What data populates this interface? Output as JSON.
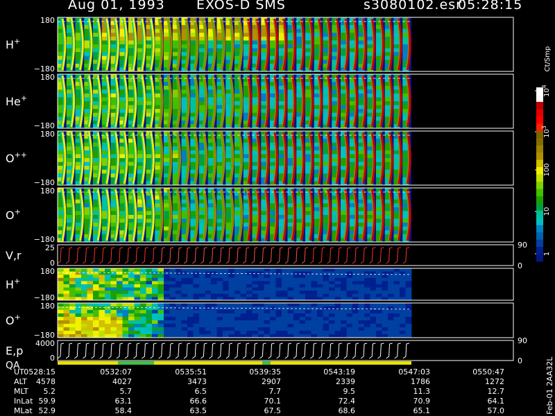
{
  "header": {
    "date": "Aug 01, 1993",
    "instrument": "EXOS-D SMS",
    "file": "s3080102.esr",
    "time": "05:28:15"
  },
  "chart_data": [
    {
      "type": "heatmap",
      "title": "Aug 01, 1993   EXOS-D SMS",
      "panels": [
        {
          "id": "h1",
          "species": "H",
          "charge": "+",
          "ylim_labels": [
            "180",
            "−180"
          ]
        },
        {
          "id": "he1",
          "species": "He",
          "charge": "+",
          "ylim_labels": [
            "180",
            "−180"
          ]
        },
        {
          "id": "o2",
          "species": "O",
          "charge": "++",
          "ylim_labels": [
            "180",
            "−180"
          ]
        },
        {
          "id": "o1",
          "species": "O",
          "charge": "+",
          "ylim_labels": [
            "180",
            "−180"
          ]
        },
        {
          "id": "vr",
          "species": "V,r",
          "charge": "",
          "ylim_labels": [
            "25",
            "0"
          ],
          "right_ticks": [
            "90",
            "0"
          ]
        },
        {
          "id": "h2",
          "species": "H",
          "charge": "+",
          "ylim_labels": [
            "180",
            "−180"
          ]
        },
        {
          "id": "o3",
          "species": "O",
          "charge": "+",
          "ylim_labels": [
            "180",
            "−180"
          ]
        },
        {
          "id": "ep",
          "species": "E,p",
          "charge": "",
          "ylim_labels": [
            "4000",
            "0"
          ],
          "right_ticks": [
            "90",
            "0"
          ],
          "extra_label": "QA"
        }
      ],
      "colorbar": {
        "unit": "Ct/Smp",
        "ticks": [
          {
            "label": "10",
            "exp": "4"
          },
          {
            "label": "10",
            "exp": "3"
          },
          {
            "label": "100",
            "exp": ""
          },
          {
            "label": "10",
            "exp": ""
          },
          {
            "label": "1",
            "exp": ""
          }
        ],
        "colors": [
          "#ffffff",
          "#ffffff",
          "#c00000",
          "#e00000",
          "#ff0000",
          "#ff2000",
          "#806000",
          "#807000",
          "#a08000",
          "#b09000",
          "#d0c000",
          "#f0f000",
          "#c0e000",
          "#80d000",
          "#40c000",
          "#20a000",
          "#00a040",
          "#00c0a0",
          "#00c0c0",
          "#0080c0",
          "#0060b0",
          "#0040a0",
          "#002090",
          "#001880"
        ]
      }
    }
  ],
  "footer_table": {
    "rows": [
      {
        "label": "UT",
        "values": [
          "0528:15",
          "0532:07",
          "0535:51",
          "0539:35",
          "0543:19",
          "0547:03",
          "0550:47"
        ]
      },
      {
        "label": "ALT",
        "values": [
          "4578",
          "4027",
          "3473",
          "2907",
          "2339",
          "1786",
          "1272"
        ]
      },
      {
        "label": "MLT",
        "values": [
          "5.2",
          "5.7",
          "6.5",
          "7.7",
          "9.5",
          "11.3",
          "12.7"
        ]
      },
      {
        "label": "InLat",
        "values": [
          "59.9",
          "63.1",
          "66.6",
          "70.1",
          "72.4",
          "70.9",
          "64.1"
        ]
      },
      {
        "label": "MLat",
        "values": [
          "52.9",
          "58.4",
          "63.5",
          "67.5",
          "68.6",
          "65.1",
          "57.0"
        ]
      }
    ]
  },
  "side_stamp": "Feb-01  2AA32L"
}
